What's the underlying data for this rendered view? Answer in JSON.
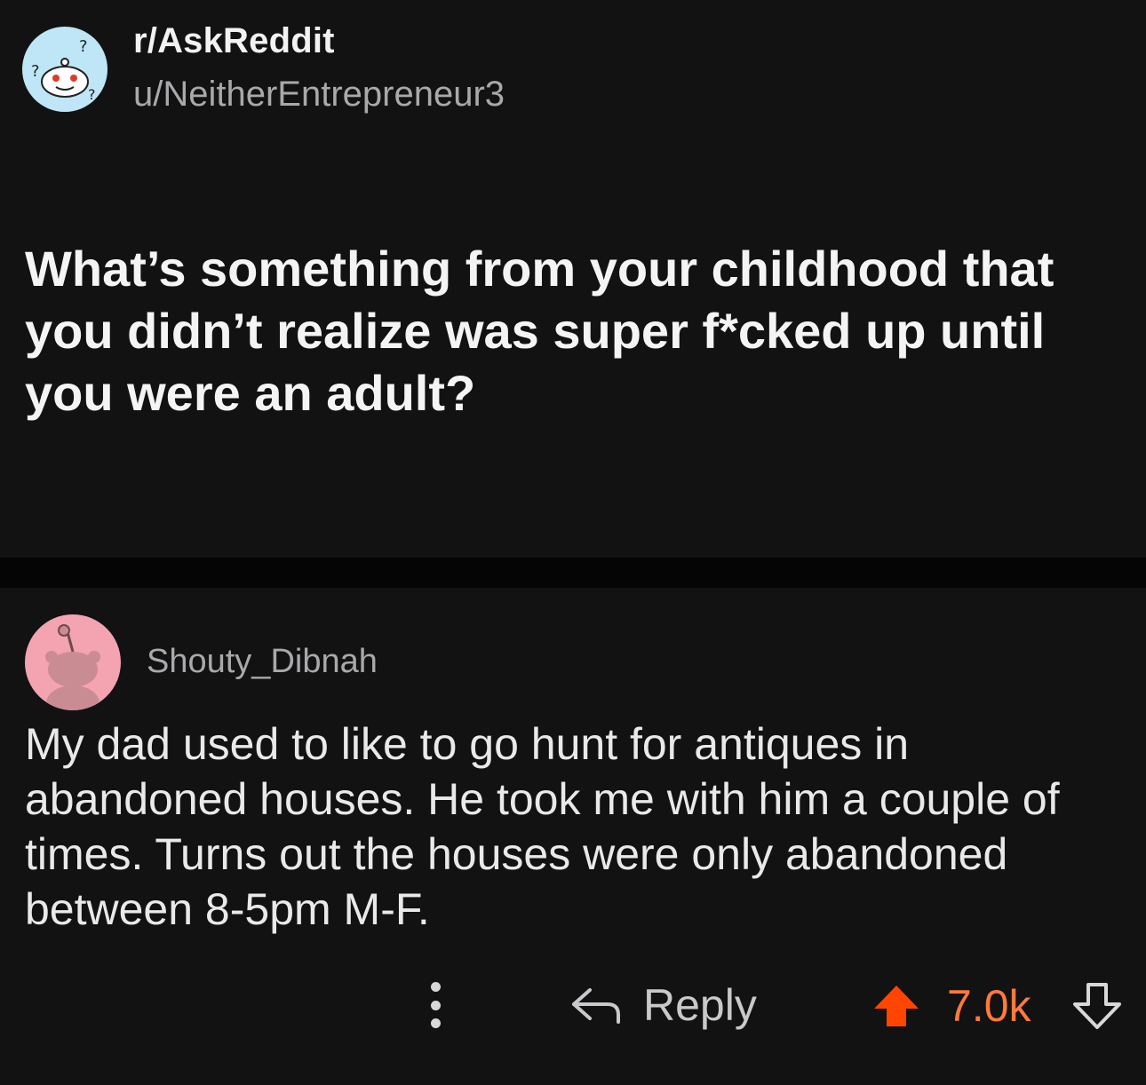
{
  "post": {
    "subreddit": "r/AskReddit",
    "author": "u/NeitherEntrepreneur3",
    "title": "What’s something from your childhood that you didn’t realize was super f*cked up until you were an adult?",
    "avatar_icon": "askreddit-snoo-icon"
  },
  "comment": {
    "author": "Shouty_Dibnah",
    "avatar_icon": "snoo-avatar-icon",
    "body": "My dad used to like to go hunt for antiques in abandoned houses.  He took me with him a couple of times.  Turns out the houses were only abandoned between 8-5pm M-F.",
    "actions": {
      "more_icon": "vertical-ellipsis-icon",
      "reply_icon": "reply-arrow-icon",
      "reply_label": "Reply",
      "upvote_icon": "upvote-arrow-icon",
      "score": "7.0k",
      "downvote_icon": "downvote-arrow-icon"
    }
  },
  "colors": {
    "background": "#121213",
    "divider": "#050505",
    "upvote_active": "#ff4500",
    "score": "#ff7a3d",
    "muted_text": "#a9a9ab"
  }
}
